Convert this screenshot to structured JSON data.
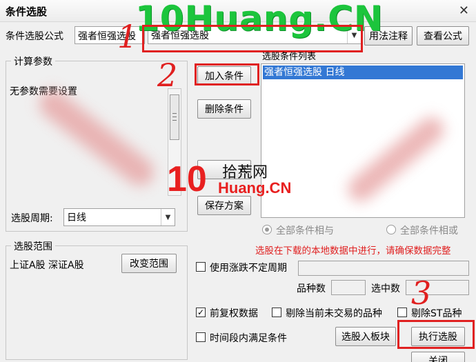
{
  "window": {
    "title": "条件选股",
    "close_glyph": "✕"
  },
  "watermark": {
    "text": "10Huang.CN"
  },
  "formula": {
    "label": "条件选股公式",
    "value": "强者恒强选股",
    "combo_value": "强者恒强选股"
  },
  "buttons": {
    "usage_notes": "用法注释",
    "view_formula": "查看公式",
    "add_condition": "加入条件",
    "delete_condition": "删除条件",
    "load_plan": "入",
    "save_plan": "保存方案",
    "change_range": "改变范围",
    "to_block": "选股入板块",
    "execute": "执行选股",
    "close": "关闭"
  },
  "params": {
    "group_title": "计算参数",
    "none_text": "无参数需要设置",
    "period_label": "选股周期:",
    "period_value": "日线"
  },
  "conditions": {
    "list_title": "选股条件列表",
    "items": [
      "强者恒强选股    日线"
    ]
  },
  "logic": {
    "all_and": "全部条件相与",
    "all_or": "全部条件相或"
  },
  "notice": "选股在下载的本地数据中进行，请确保数据完整",
  "range": {
    "group_title": "选股范围",
    "value": "上证A股 深证A股"
  },
  "options": {
    "variable_period": "使用涨跌不定周期",
    "variety_count_label": "品种数",
    "selected_count_label": "选中数",
    "forward_adjust": "前复权数据",
    "exclude_untraded": "剔除当前未交易的品种",
    "exclude_st": "剔除ST品种",
    "time_range": "时间段内满足条件",
    "check_mark": "✓"
  },
  "annotations": {
    "n1": "1",
    "n2": "2",
    "n3": "3"
  },
  "logo": {
    "num": "10",
    "line1": "拾荒网",
    "line2": "Huang.CN"
  },
  "colors": {
    "accent_red": "#e02020",
    "selection_blue": "#3378d4",
    "watermark_green": "#1cc53c"
  },
  "icons": {
    "dropdown": "▼"
  }
}
